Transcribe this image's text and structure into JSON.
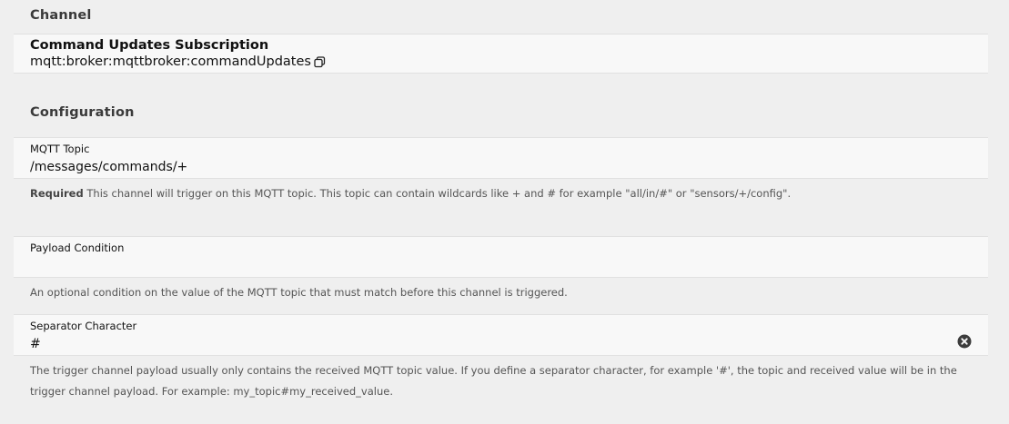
{
  "channel_section": {
    "title": "Channel",
    "channel_name": "Command Updates Subscription",
    "channel_uid": "mqtt:broker:mqttbroker:commandUpdates",
    "copy_icon": "copy-icon"
  },
  "configuration_section": {
    "title": "Configuration",
    "fields": [
      {
        "label": "MQTT Topic",
        "value": "/messages/commands/+",
        "help_required": "Required",
        "help_text": " This channel will trigger on this MQTT topic. This topic can contain wildcards like + and # for example \"all/in/#\" or \"sensors/+/config\"."
      },
      {
        "label": "Payload Condition",
        "value": "",
        "help_text": "An optional condition on the value of the MQTT topic that must match before this channel is triggered."
      },
      {
        "label": "Separator Character",
        "value": "#",
        "clear_icon": "clear-icon",
        "help_text": "The trigger channel payload usually only contains the received MQTT topic value. If you define a separator character, for example '#', the topic and received value will be in the trigger channel payload. For example: my_topic#my_received_value."
      }
    ]
  }
}
